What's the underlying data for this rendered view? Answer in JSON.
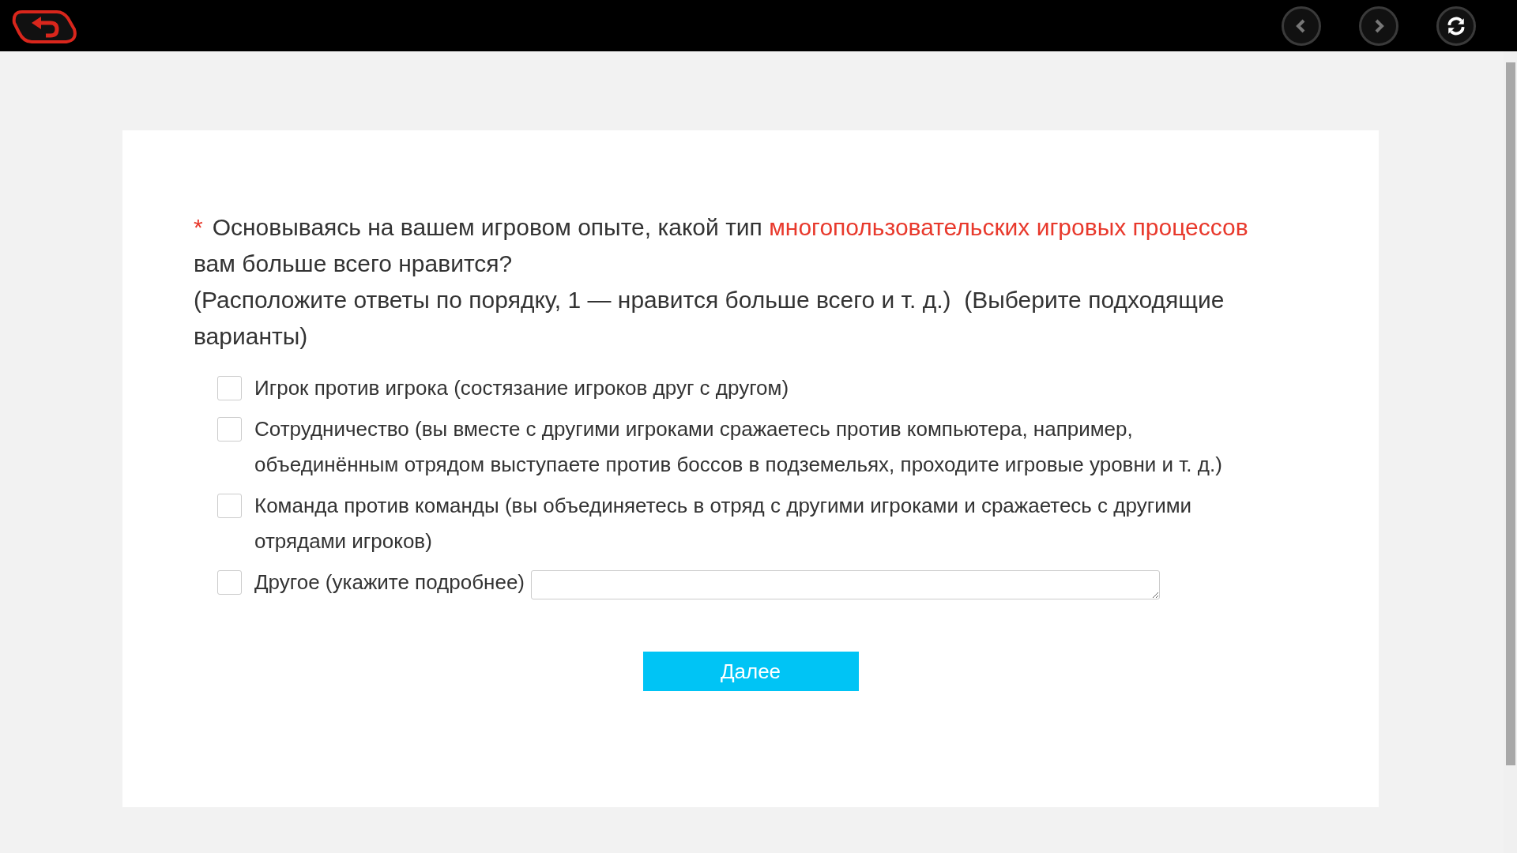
{
  "question": {
    "required_mark": "*",
    "segments": [
      {
        "text": "Основываясь на вашем игровом опыте, какой тип ",
        "highlight": false
      },
      {
        "text": "многопользовательских игровых процессов",
        "highlight": true
      },
      {
        "text": " вам больше всего нравится?",
        "highlight": false
      }
    ],
    "hint": "(Расположите ответы по порядку, 1 — нравится больше всего и т. д.)  (Выберите подходящие варианты)"
  },
  "options": [
    {
      "kind": "checkbox",
      "label": "Игрок против игрока (состязание игроков друг с другом)",
      "checked": false
    },
    {
      "kind": "checkbox",
      "label": "Сотрудничество (вы вместе с другими игроками сражаетесь против компьютера, например, объединённым отрядом выступаете против боссов в подземельях, проходите игровые уровни и т. д.)",
      "checked": false
    },
    {
      "kind": "checkbox",
      "label": "Команда против команды (вы объединяетесь в отряд с другими игроками и сражаетесь с другими отрядами игроков)",
      "checked": false
    },
    {
      "kind": "checkbox_with_field",
      "label": "Другое (укажите подробнее)",
      "checked": false
    }
  ],
  "next_button": "Далее"
}
